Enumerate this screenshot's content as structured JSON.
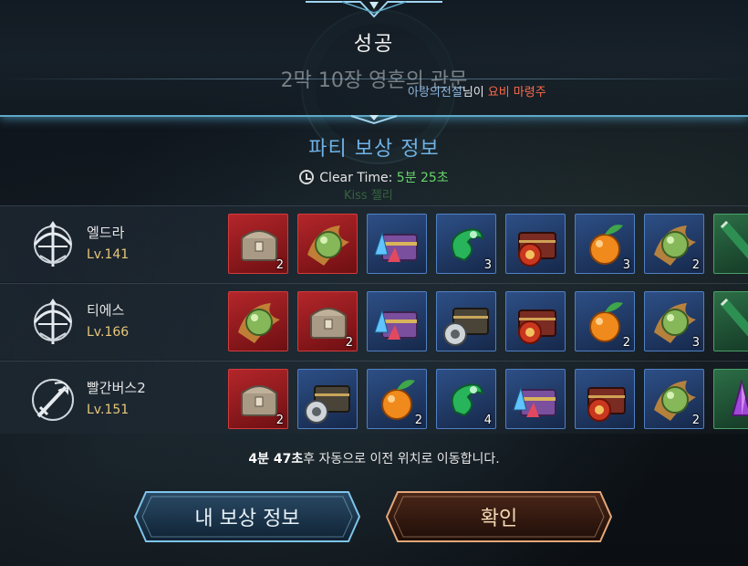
{
  "header": {
    "title": "성공",
    "stage_name": "2막 10장 영혼의 관문",
    "notice_player": "아랑의전설",
    "notice_suffix": "님이",
    "notice_item": "요비 마령주"
  },
  "rewards": {
    "section_title": "파티 보상 정보",
    "clear_time_label": "Clear Time:",
    "clear_time_value": "5분 25초",
    "ghost_text": "Kiss 젤리"
  },
  "party": [
    {
      "name": "엘드라",
      "level": "Lv.141",
      "class_icon": "crossbow-icon",
      "items": [
        {
          "icon": "silver-chest-icon",
          "frame": "red",
          "qty": "2"
        },
        {
          "icon": "green-orb-icon",
          "frame": "red",
          "qty": ""
        },
        {
          "icon": "purple-crystal-chest-icon",
          "frame": "blue",
          "qty": ""
        },
        {
          "icon": "green-jade-icon",
          "frame": "blue",
          "qty": "3"
        },
        {
          "icon": "red-orb-chest-icon",
          "frame": "blue",
          "qty": ""
        },
        {
          "icon": "orange-fruit-icon",
          "frame": "blue",
          "qty": "3"
        },
        {
          "icon": "green-orb-icon",
          "frame": "blue",
          "qty": "2"
        },
        {
          "icon": "green-scroll-icon",
          "frame": "green",
          "qty": ""
        }
      ]
    },
    {
      "name": "티에스",
      "level": "Lv.166",
      "class_icon": "crossbow-icon",
      "items": [
        {
          "icon": "green-orb-icon",
          "frame": "red",
          "qty": ""
        },
        {
          "icon": "silver-chest-icon",
          "frame": "red",
          "qty": "2"
        },
        {
          "icon": "purple-crystal-chest-icon",
          "frame": "blue",
          "qty": ""
        },
        {
          "icon": "coin-chest-icon",
          "frame": "blue",
          "qty": ""
        },
        {
          "icon": "red-orb-chest-icon",
          "frame": "blue",
          "qty": ""
        },
        {
          "icon": "orange-fruit-icon",
          "frame": "blue",
          "qty": "2"
        },
        {
          "icon": "green-orb-icon",
          "frame": "blue",
          "qty": "3"
        },
        {
          "icon": "green-scroll-icon",
          "frame": "green",
          "qty": ""
        }
      ]
    },
    {
      "name": "빨간버스2",
      "level": "Lv.151",
      "class_icon": "dragon-sword-icon",
      "items": [
        {
          "icon": "silver-chest-icon",
          "frame": "red",
          "qty": "2"
        },
        {
          "icon": "coin-chest-icon",
          "frame": "blue",
          "qty": ""
        },
        {
          "icon": "orange-fruit-icon",
          "frame": "blue",
          "qty": "2"
        },
        {
          "icon": "green-jade-icon",
          "frame": "blue",
          "qty": "4"
        },
        {
          "icon": "purple-crystal-chest-icon",
          "frame": "blue",
          "qty": ""
        },
        {
          "icon": "red-orb-chest-icon",
          "frame": "blue",
          "qty": ""
        },
        {
          "icon": "green-orb-icon",
          "frame": "blue",
          "qty": "2"
        },
        {
          "icon": "purple-crystal-icon",
          "frame": "green",
          "qty": ""
        }
      ]
    }
  ],
  "footer": {
    "countdown_time": "4분 47초",
    "countdown_text": "후 자동으로 이전 위치로 이동합니다.",
    "my_reward_button": "내 보상 정보",
    "confirm_button": "확인"
  },
  "colors": {
    "accent_blue": "#6fb2e6",
    "clear_time_green": "#67d66a",
    "level_gold": "#e8c77a",
    "item_highlight": "#ff6a4a"
  }
}
